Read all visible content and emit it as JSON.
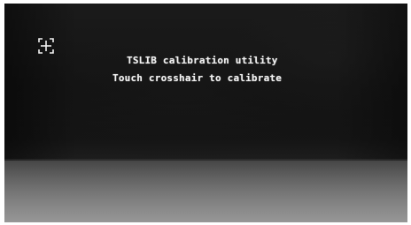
{
  "screen": {
    "title": "TSLIB calibration utility",
    "instruction": "Touch crosshair to calibrate"
  },
  "crosshair": {
    "icon": "crosshair-icon",
    "color": "#f2f2f2"
  }
}
